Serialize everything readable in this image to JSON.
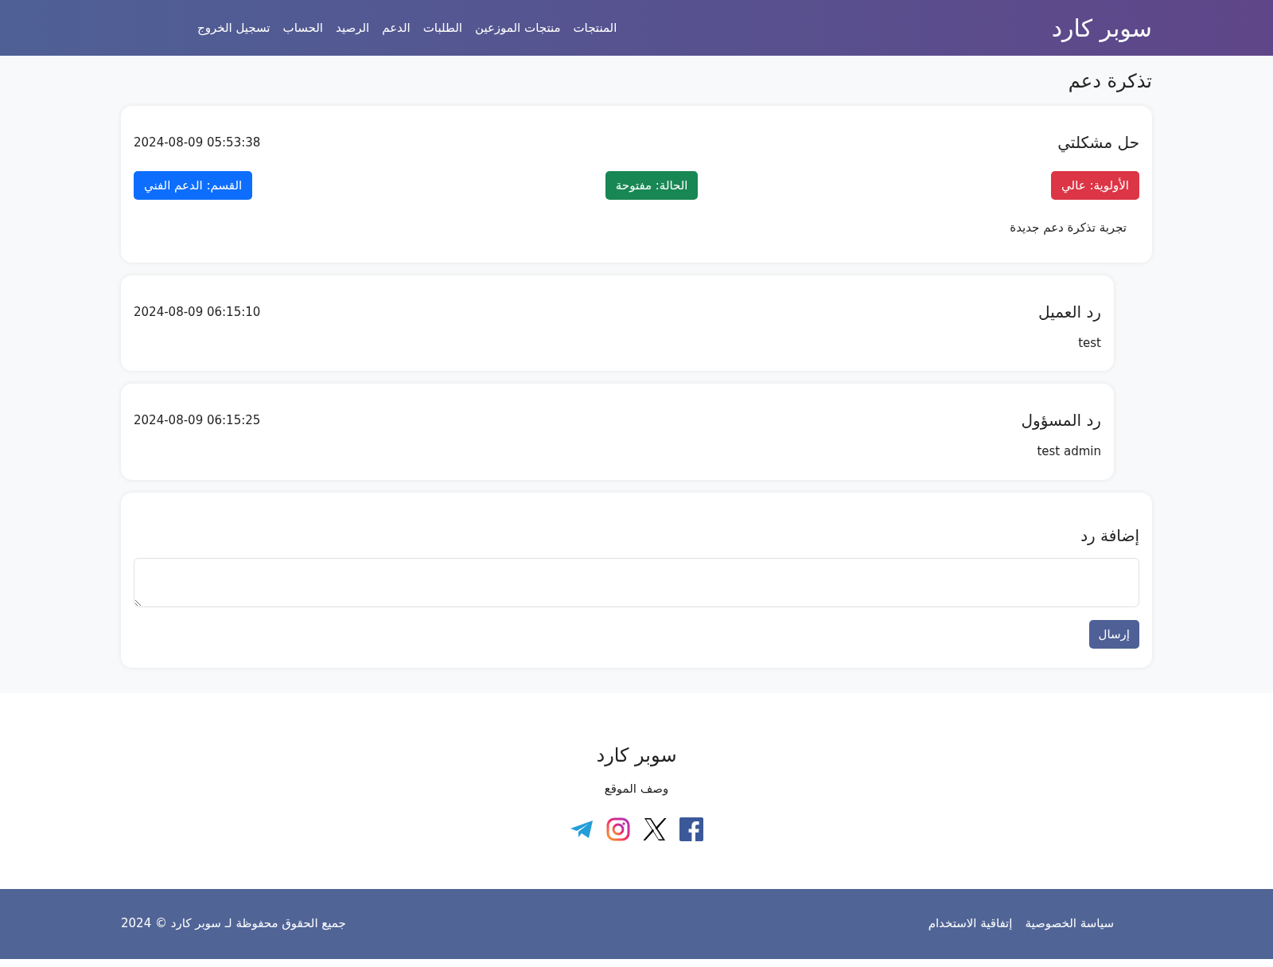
{
  "navbar": {
    "brand": "سوبر كارد",
    "links": [
      "المنتجات",
      "منتجات الموزعين",
      "الطلبات",
      "الدعم",
      "الرصيد",
      "الحساب",
      "تسجيل الخروج"
    ]
  },
  "page_title": "تذكرة دعم",
  "ticket": {
    "title": "حل مشكلتي",
    "date": "2024-08-09 05:53:38",
    "tags": [
      {
        "label": "الأولوية: عالي",
        "color": "#dc3545"
      },
      {
        "label": "الحالة: مفتوحة",
        "color": "#198754"
      },
      {
        "label": "القسم: الدعم الفني",
        "color": "#0d6efd"
      }
    ],
    "description": "تجربة تذكرة دعم جديدة"
  },
  "replies": [
    {
      "author": "رد العميل",
      "date": "2024-08-09 06:15:10",
      "text": "test"
    },
    {
      "author": "رد المسؤول",
      "date": "2024-08-09 06:15:25",
      "text": "test admin"
    }
  ],
  "reply_form": {
    "title": "إضافة رد",
    "button": "إرسال"
  },
  "footer": {
    "brand": "سوبر كارد",
    "description": "وصف الموقع"
  },
  "bottom_bar": {
    "links": [
      "سياسة الخصوصية",
      "إتفاقية الاستخدام"
    ],
    "copyright": "جميع الحقوق محفوظة لـ سوبر كارد © 2024"
  }
}
